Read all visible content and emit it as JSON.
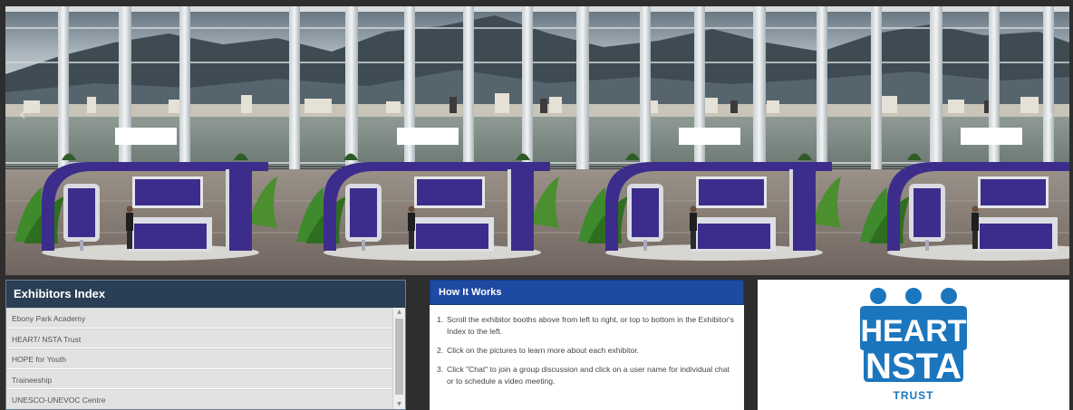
{
  "carousel": {
    "prev_glyph": "‹",
    "next_glyph": "›",
    "booth_count": 4,
    "colors": {
      "booth_purple": "#3c2d8c",
      "booth_frame": "#6a5fb0",
      "sky": "#b7c3cc",
      "mountain": "#3d4a52",
      "water": "#7f8c86",
      "floor": "#8a8079"
    }
  },
  "exhibitors": {
    "title": "Exhibitors Index",
    "items": [
      {
        "label": "Ebony Park Academy"
      },
      {
        "label": "HEART/ NSTA Trust"
      },
      {
        "label": "HOPE for Youth"
      },
      {
        "label": "Traineeship"
      },
      {
        "label": "UNESCO-UNEVOC Centre"
      }
    ]
  },
  "how_it_works": {
    "title": "How It Works",
    "steps": [
      {
        "num": "1.",
        "text": "Scroll the exhibitor booths above from left to right, or top to bottom in the Exhibitor's Index to the left."
      },
      {
        "num": "2.",
        "text": "Click on the pictures to learn more about each exhibitor."
      },
      {
        "num": "3.",
        "text": "Click \"Chat\" to join a group discussion and click on a user name for individual chat or to schedule a video meeting."
      }
    ]
  },
  "logo": {
    "line1": "HEART",
    "line2": "NSTA",
    "line3": "TRUST",
    "brand_color": "#1b76bd"
  }
}
